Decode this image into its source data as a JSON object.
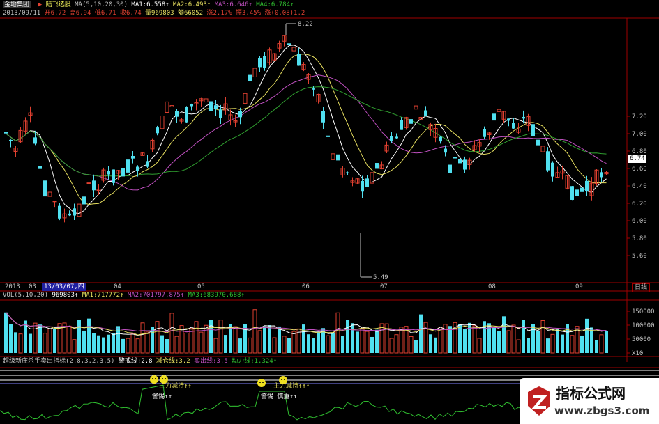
{
  "header": {
    "company": "金地集团",
    "app_title": "陆飞选股",
    "ma_params": "MA(5,10,20,30)",
    "ma1": "MA1:6.558↑",
    "ma2": "MA2:6.493↑",
    "ma3": "MA3:6.646↑",
    "ma4": "MA4:6.784↑"
  },
  "info": {
    "date": "2013/09/11",
    "open": "开6.72",
    "high": "高6.94",
    "low": "低6.71",
    "close": "收6.74",
    "volume": "量969803",
    "amount": "额66052",
    "change": "涨2.17%",
    "amplitude": "振3.45%",
    "rise": "涨(0.08)1.2"
  },
  "price_axis": {
    "ticks": [
      "7.20",
      "7.00",
      "6.80",
      "6.60",
      "6.40",
      "6.20",
      "6.00",
      "5.80",
      "5.60"
    ],
    "current": "6.74"
  },
  "annotations": {
    "high": "8.22",
    "low": "5.49"
  },
  "timeline": {
    "year": "2013",
    "m03": "03",
    "cursor": "13/03/07,四",
    "months": [
      "04",
      "05",
      "06",
      "07",
      "08",
      "09"
    ],
    "period": "日线"
  },
  "volume_panel": {
    "title": "VOL(5,10,20)",
    "value": "969803↑",
    "ma1": "MA1:717772↑",
    "ma2": "MA2:701797.875↑",
    "ma3": "MA3:683970.688↑",
    "ticks": [
      "150000",
      "100000",
      "50000",
      "X10"
    ]
  },
  "indicator_panel": {
    "title": "超级新庄杀手卖出指标(2.8,3.2,3.5)",
    "warn": "警戒线:2.8",
    "reduce": "减仓线:3.2",
    "sell": "卖出线:3.5",
    "power": "动力线:1.324↑",
    "marker1": "主力减持↑↑",
    "marker2": "警惕↑↑",
    "marker3": "主力减持↑↑↑",
    "marker4": "警惕 慎重↑↑"
  },
  "colors": {
    "up": "#e04030",
    "down": "#50e0f0",
    "ma_white": "#ffffff",
    "ma_yellow": "#e8e060",
    "ma_purple": "#c050c0",
    "ma_green": "#30a030",
    "axis_red": "#a00000",
    "power": "#30c030"
  },
  "watermark": {
    "title": "指标公式网",
    "url": "www.zbgs3.com"
  }
}
